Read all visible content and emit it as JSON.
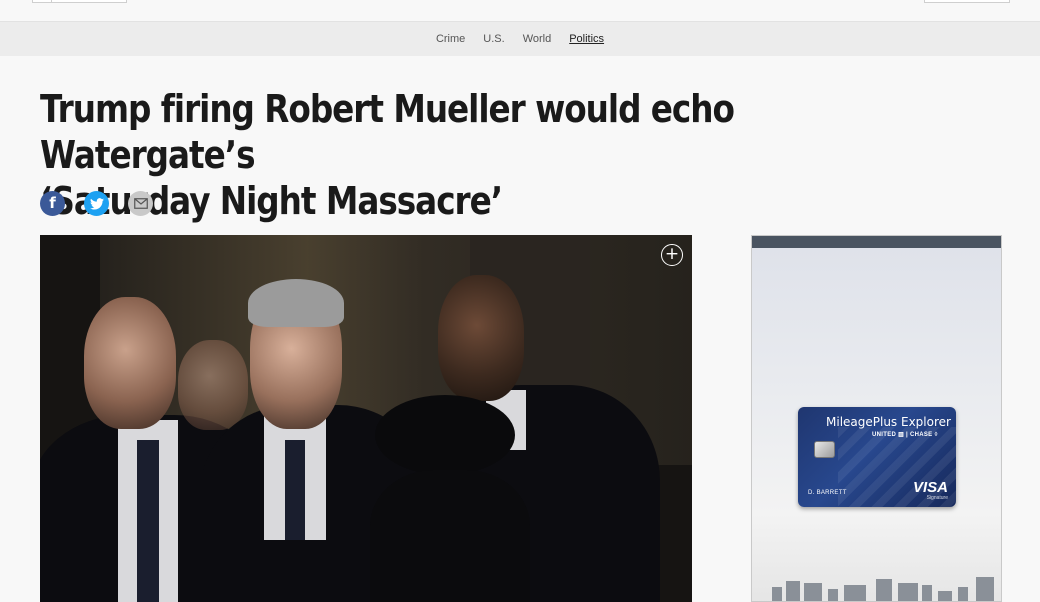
{
  "nav": {
    "items": [
      {
        "label": "Crime",
        "active": false
      },
      {
        "label": "U.S.",
        "active": false
      },
      {
        "label": "World",
        "active": false
      },
      {
        "label": "Politics",
        "active": true
      }
    ]
  },
  "article": {
    "headline_line1": "Trump firing Robert Mueller would echo Watergate’s",
    "headline_line2": "‘Saturday Night Massacre’"
  },
  "share": {
    "facebook_icon": "f",
    "twitter_icon": "twitter-bird",
    "email_icon": "envelope"
  },
  "hero": {
    "expand_icon": "+"
  },
  "ad": {
    "card_title": "MileagePlus Explorer",
    "card_brands": "UNITED ▥ | CHASE ◊",
    "cardholder": "D. BARRETT",
    "network": "VISA",
    "network_tier": "Signature"
  },
  "colors": {
    "facebook": "#3b5998",
    "twitter": "#1da1f2",
    "email": "#c9c9c9",
    "card": "#1f3670"
  }
}
